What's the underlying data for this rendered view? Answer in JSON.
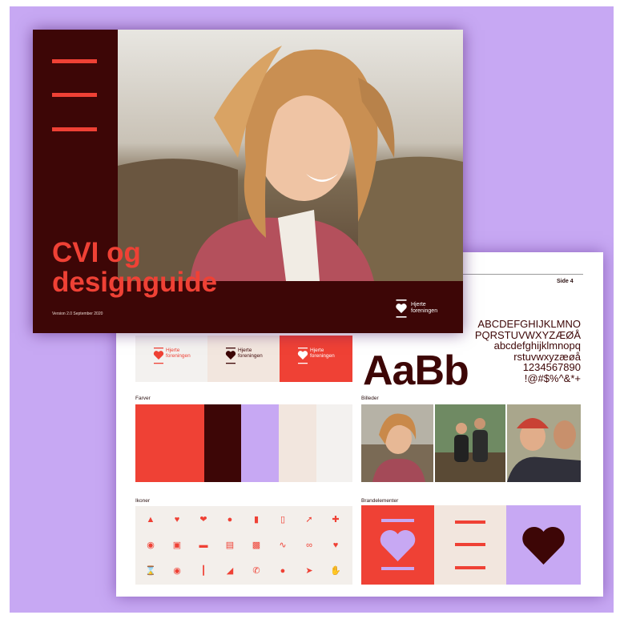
{
  "cover": {
    "title_line1": "CVI og",
    "title_line2": "designguide",
    "version": "Version 2.0 September 2020",
    "logo_line1": "Hjerte",
    "logo_line2": "foreningen"
  },
  "spread": {
    "page_number": "Side 4",
    "logo_line1": "Hjerte",
    "logo_line2": "foreningen",
    "type_sample": "AaBb",
    "glyph_rows": [
      "ABCDEFGHIJKLMNO",
      "PQRSTUVWXYZÆØÅ",
      "abcdefghijklmnopq",
      "rstuvwxyzæøå",
      "1234567890",
      "!@#$%^&*+"
    ],
    "sections": {
      "colors": "Farver",
      "images": "Billeder",
      "icons": "Ikoner",
      "brand": "Brandelementer"
    }
  },
  "colors": {
    "background": "#c7a8f3",
    "red": "#ef4135",
    "dark_red": "#3d0606",
    "lilac": "#c7a8f3",
    "beige": "#f2e6de",
    "light_gray": "#f3f1ef"
  },
  "icons": [
    "yoga-icon",
    "heart-icon",
    "heart-organ-icon",
    "doctor-icon",
    "bandage-icon",
    "phone-heart-icon",
    "syringe-icon",
    "first-aid-cross-icon",
    "pills-icon",
    "medicine-bottle-icon",
    "patient-bed-icon",
    "clipboard-icon",
    "first-aid-kit-icon",
    "heart-monitor-icon",
    "stethoscope-icon",
    "heart-plus-icon",
    "hourglass-icon",
    "eye-icon",
    "thermometer-icon",
    "person-reading-icon",
    "phone-icon",
    "capsules-icon",
    "running-icon",
    "helping-hand-icon"
  ]
}
